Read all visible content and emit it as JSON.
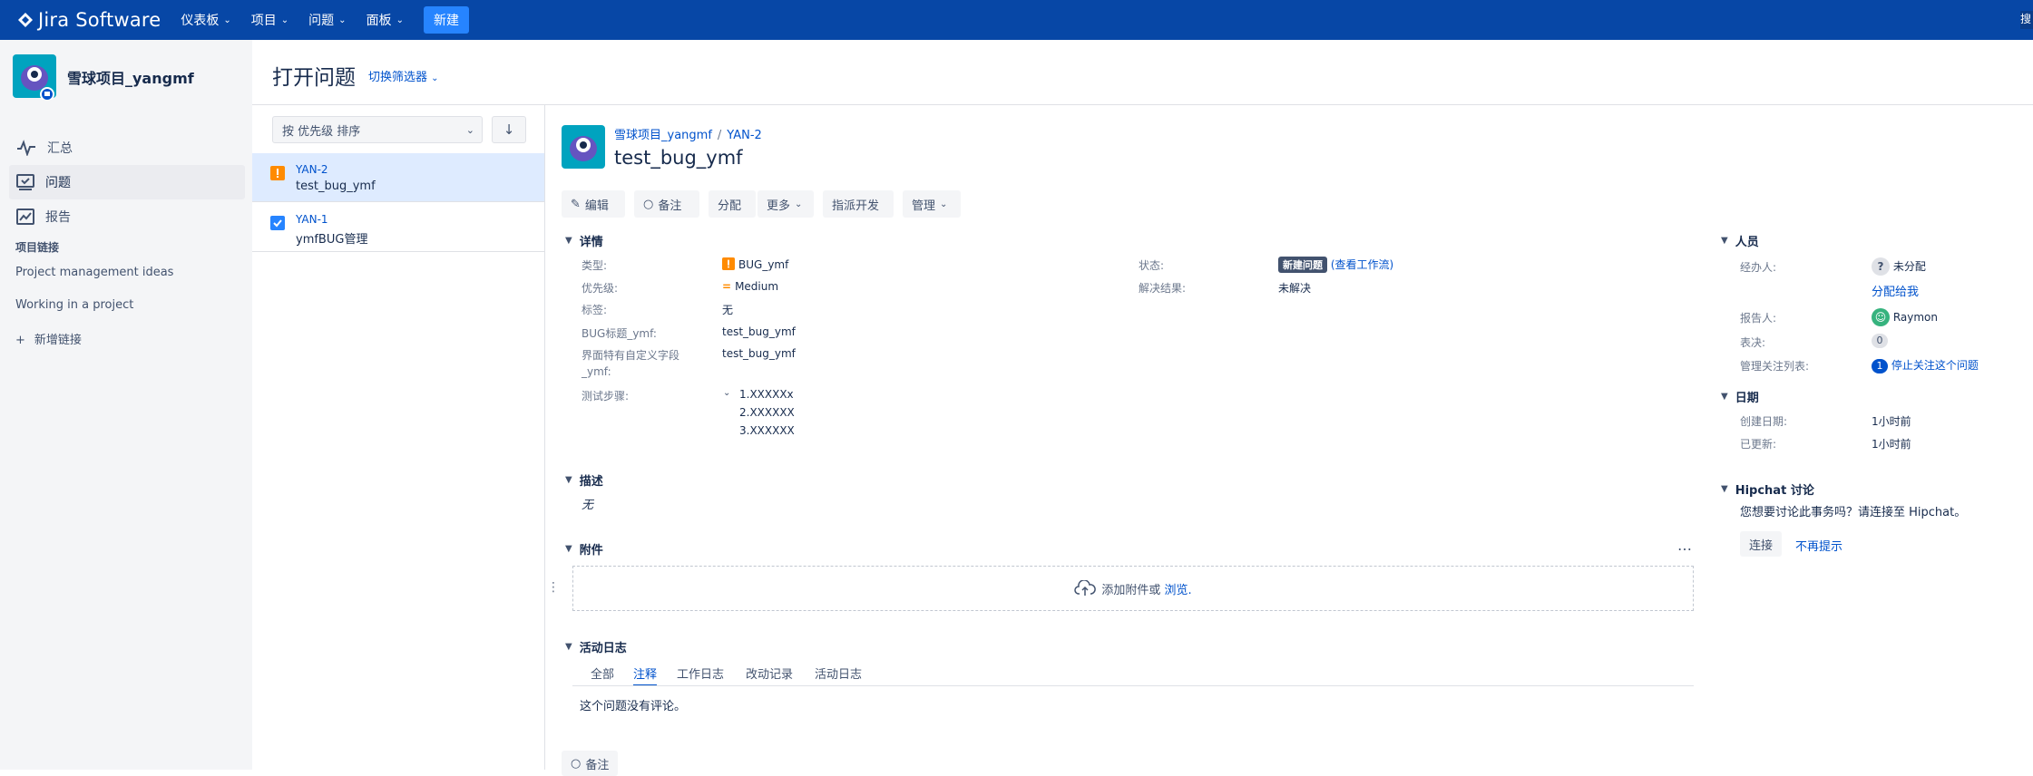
{
  "nav": {
    "brand": "Jira Software",
    "items": [
      "仪表板",
      "项目",
      "问题",
      "面板"
    ],
    "create_label": "新建",
    "right_cut": "搜"
  },
  "sidebar": {
    "project_name": "雪球项目_yangmf",
    "items": [
      {
        "label": "汇总",
        "icon": "activity-icon"
      },
      {
        "label": "问题",
        "icon": "issues-icon"
      },
      {
        "label": "报告",
        "icon": "reports-icon"
      }
    ],
    "links_heading": "项目链接",
    "links": [
      "Project management ideas",
      "Working in a project"
    ],
    "add_link": "新增链接"
  },
  "header": {
    "title": "打开问题",
    "filter_switch": "切换筛选器"
  },
  "issue_list": {
    "sort_label": "按 优先级 排序",
    "sort_direction_icon": "arrow-down-icon",
    "issues": [
      {
        "key": "YAN-2",
        "summary": "test_bug_ymf",
        "type": "bug",
        "selected": true
      },
      {
        "key": "YAN-1",
        "summary": "ymfBUG管理",
        "type": "task",
        "selected": false
      }
    ]
  },
  "issue": {
    "project": "雪球项目_yangmf",
    "key": "YAN-2",
    "title": "test_bug_ymf",
    "toolbar": {
      "edit": "编辑",
      "comment": "备注",
      "assign": "分配",
      "more": "更多",
      "dispatch": "指派开发",
      "manage": "管理"
    },
    "details": {
      "heading": "详情",
      "type_label": "类型:",
      "type_value": "BUG_ymf",
      "priority_label": "优先级:",
      "priority_value": "Medium",
      "labels_label": "标签:",
      "labels_value": "无",
      "bug_title_label": "BUG标题_ymf:",
      "bug_title_value": "test_bug_ymf",
      "ui_field_label_1": "界面特有自定义字段",
      "ui_field_label_2": "_ymf:",
      "ui_field_value": "test_bug_ymf",
      "steps_label": "测试步骤:",
      "steps": [
        "1.XXXXXx",
        "2.XXXXXX",
        "3.XXXXXX"
      ],
      "status_label": "状态:",
      "status_value": "新建问题",
      "workflow_link": "(查看工作流)",
      "resolution_label": "解决结果:",
      "resolution_value": "未解决"
    },
    "description": {
      "heading": "描述",
      "value": "无"
    },
    "attachments": {
      "heading": "附件",
      "drop_text": "添加附件或",
      "browse": "浏览."
    },
    "activity": {
      "heading": "活动日志",
      "tabs": [
        "全部",
        "注释",
        "工作日志",
        "改动记录",
        "活动日志"
      ],
      "active_tab": "注释",
      "empty": "这个问题没有评论。"
    },
    "bottom_comment": "备注"
  },
  "people": {
    "heading": "人员",
    "assignee_label": "经办人:",
    "assignee_value": "未分配",
    "assign_to_me": "分配给我",
    "reporter_label": "报告人:",
    "reporter_value": "Raymon",
    "votes_label": "表决:",
    "votes_value": "0",
    "watchers_label": "管理关注列表:",
    "watchers_count": "1",
    "stop_watching": "停止关注这个问题"
  },
  "dates": {
    "heading": "日期",
    "created_label": "创建日期:",
    "created_value": "1小时前",
    "updated_label": "已更新:",
    "updated_value": "1小时前"
  },
  "hipchat": {
    "heading": "Hipchat 讨论",
    "prompt": "您想要讨论此事务吗？请连接至 Hipchat。",
    "connect": "连接",
    "dismiss": "不再提示"
  },
  "colors": {
    "nav_bg": "#0747a6",
    "accent": "#0052cc",
    "bug_orange": "#ff8b00",
    "selected_row": "#deebff"
  }
}
